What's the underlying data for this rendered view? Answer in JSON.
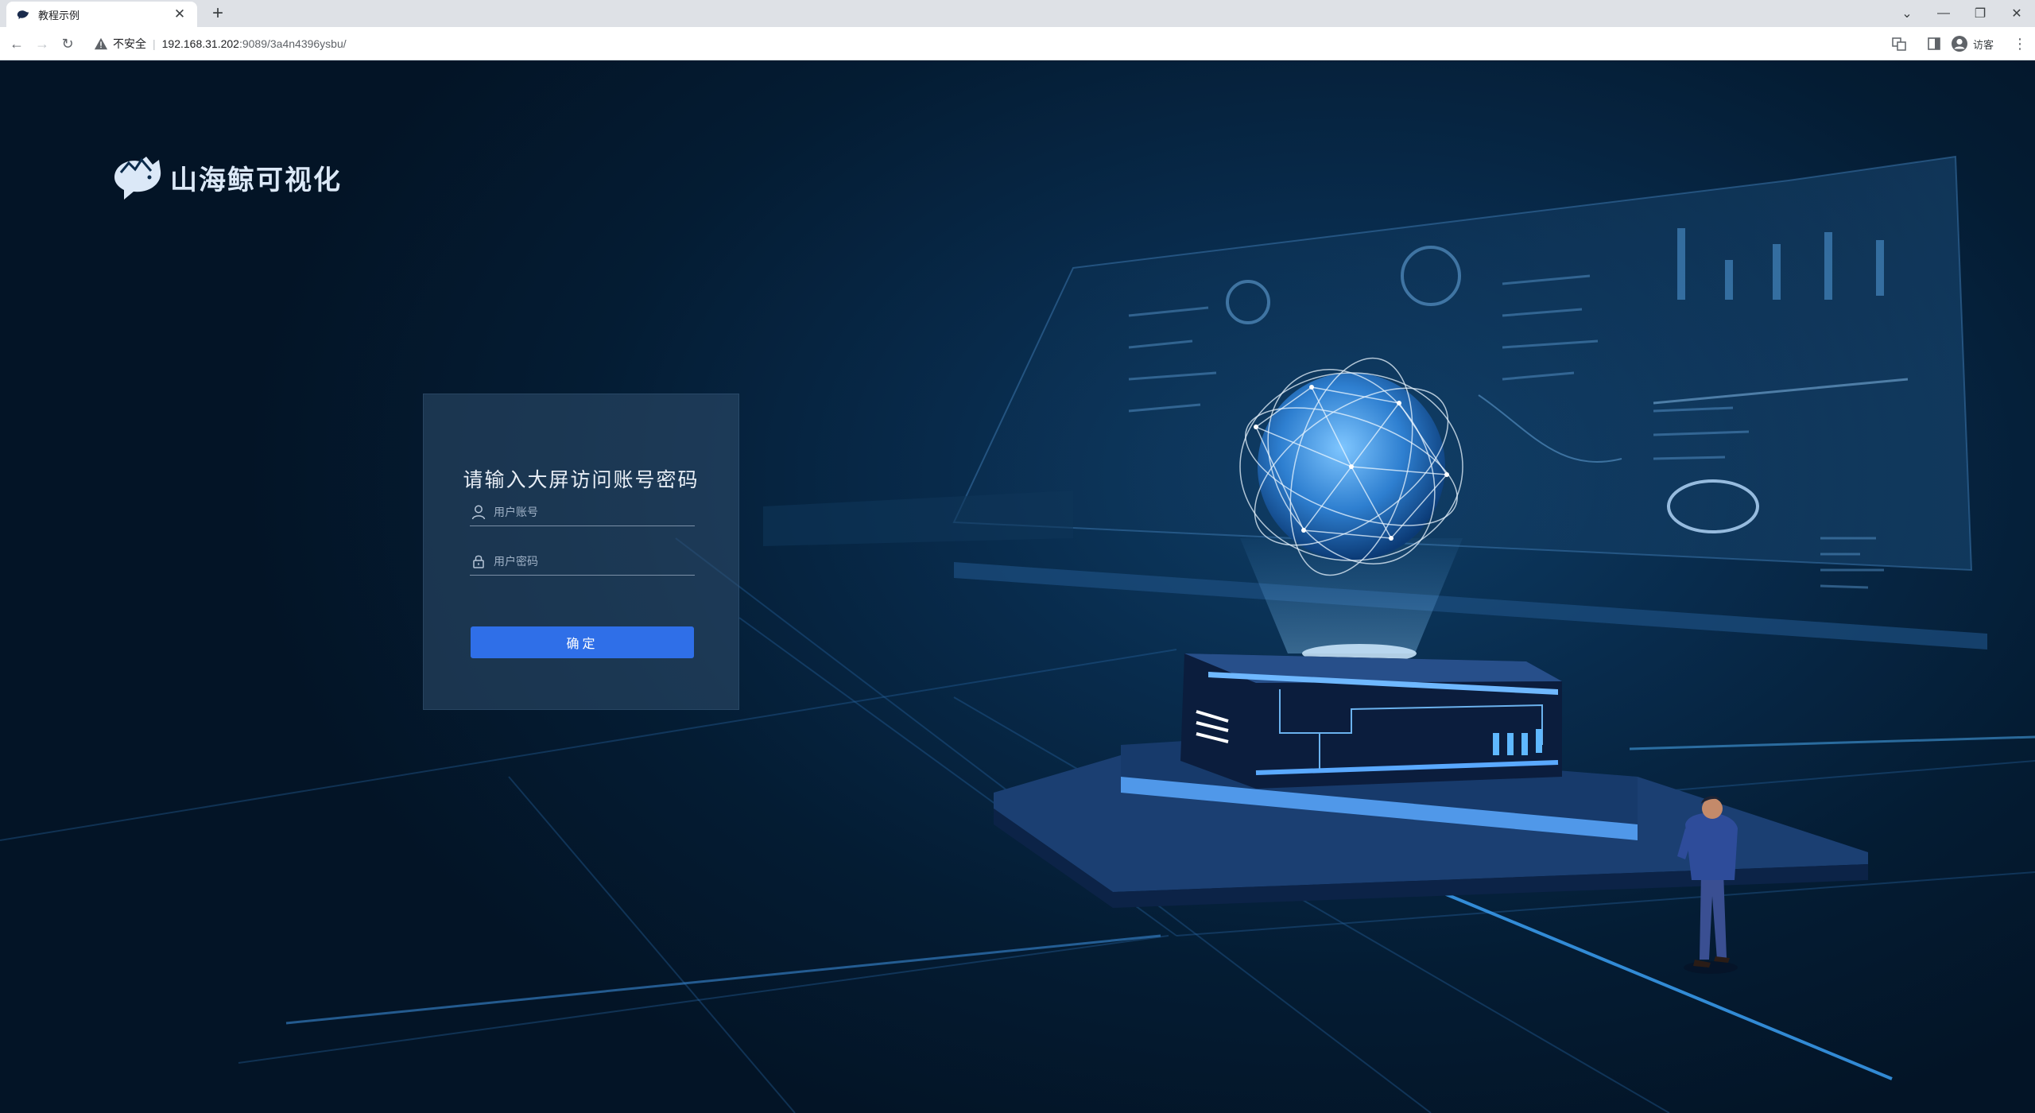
{
  "browser": {
    "tab_title": "教程示例",
    "address": {
      "security_label": "不安全",
      "host": "192.168.31.202",
      "path": ":9089/3a4n4396ysbu/"
    },
    "profile_label": "访客"
  },
  "page": {
    "logo_text": "山海鲸可视化",
    "login": {
      "title": "请输入大屏访问账号密码",
      "username_placeholder": "用户账号",
      "password_placeholder": "用户密码",
      "submit_label": "确定"
    }
  },
  "colors": {
    "accent_button": "#2f6fe8",
    "background": "#041a2e"
  }
}
